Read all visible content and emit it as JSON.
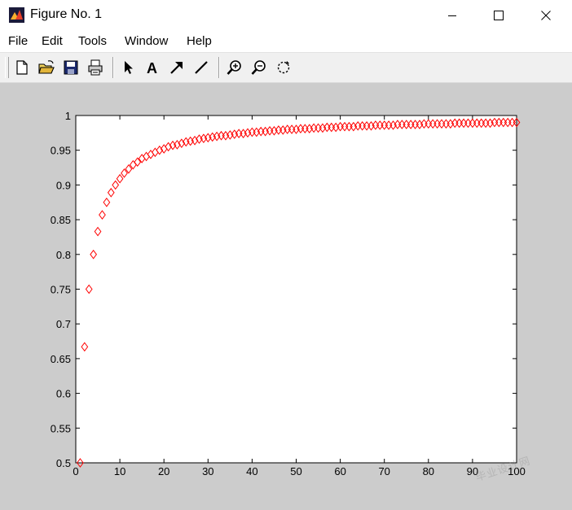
{
  "window": {
    "title": "Figure No. 1",
    "controls": {
      "minimize": "minimize",
      "maximize": "maximize",
      "close": "close"
    }
  },
  "menu": {
    "file": "File",
    "edit": "Edit",
    "tools": "Tools",
    "window": "Window",
    "help": "Help"
  },
  "toolbar": {
    "icons": [
      "new-figure-icon",
      "open-icon",
      "save-icon",
      "print-icon",
      "select-arrow-icon",
      "text-icon",
      "arrow-icon",
      "line-icon",
      "zoom-in-icon",
      "zoom-out-icon",
      "rotate-icon"
    ]
  },
  "colors": {
    "figure_background": "#cccccc",
    "axes_background": "#ffffff",
    "marker": "#ff0000"
  },
  "chart_data": {
    "type": "scatter",
    "marker": "diamond",
    "marker_color": "#ff0000",
    "title": "",
    "xlabel": "",
    "ylabel": "",
    "xlim": [
      0,
      100
    ],
    "ylim": [
      0.5,
      1
    ],
    "xticks": [
      "0",
      "10",
      "20",
      "30",
      "40",
      "50",
      "60",
      "70",
      "80",
      "90",
      "100"
    ],
    "yticks": [
      "0.5",
      "0.55",
      "0.6",
      "0.65",
      "0.7",
      "0.75",
      "0.8",
      "0.85",
      "0.9",
      "0.95",
      "1"
    ],
    "grid": false,
    "x": [
      1,
      2,
      3,
      4,
      5,
      6,
      7,
      8,
      9,
      10,
      11,
      12,
      13,
      14,
      15,
      16,
      17,
      18,
      19,
      20,
      21,
      22,
      23,
      24,
      25,
      26,
      27,
      28,
      29,
      30,
      31,
      32,
      33,
      34,
      35,
      36,
      37,
      38,
      39,
      40,
      41,
      42,
      43,
      44,
      45,
      46,
      47,
      48,
      49,
      50,
      51,
      52,
      53,
      54,
      55,
      56,
      57,
      58,
      59,
      60,
      61,
      62,
      63,
      64,
      65,
      66,
      67,
      68,
      69,
      70,
      71,
      72,
      73,
      74,
      75,
      76,
      77,
      78,
      79,
      80,
      81,
      82,
      83,
      84,
      85,
      86,
      87,
      88,
      89,
      90,
      91,
      92,
      93,
      94,
      95,
      96,
      97,
      98,
      99,
      100
    ],
    "y": [
      0.5,
      0.667,
      0.75,
      0.8,
      0.833,
      0.857,
      0.875,
      0.889,
      0.9,
      0.909,
      0.917,
      0.923,
      0.929,
      0.933,
      0.938,
      0.941,
      0.944,
      0.947,
      0.95,
      0.952,
      0.955,
      0.957,
      0.958,
      0.96,
      0.962,
      0.963,
      0.964,
      0.966,
      0.967,
      0.968,
      0.969,
      0.97,
      0.971,
      0.971,
      0.972,
      0.973,
      0.974,
      0.974,
      0.975,
      0.976,
      0.976,
      0.977,
      0.977,
      0.978,
      0.978,
      0.979,
      0.979,
      0.98,
      0.98,
      0.98,
      0.981,
      0.981,
      0.981,
      0.982,
      0.982,
      0.982,
      0.983,
      0.983,
      0.983,
      0.984,
      0.984,
      0.984,
      0.984,
      0.985,
      0.985,
      0.985,
      0.985,
      0.986,
      0.986,
      0.986,
      0.986,
      0.986,
      0.987,
      0.987,
      0.987,
      0.987,
      0.987,
      0.987,
      0.988,
      0.988,
      0.988,
      0.988,
      0.988,
      0.988,
      0.988,
      0.989,
      0.989,
      0.989,
      0.989,
      0.989,
      0.989,
      0.989,
      0.989,
      0.989,
      0.99,
      0.99,
      0.99,
      0.99,
      0.99,
      0.99
    ]
  }
}
